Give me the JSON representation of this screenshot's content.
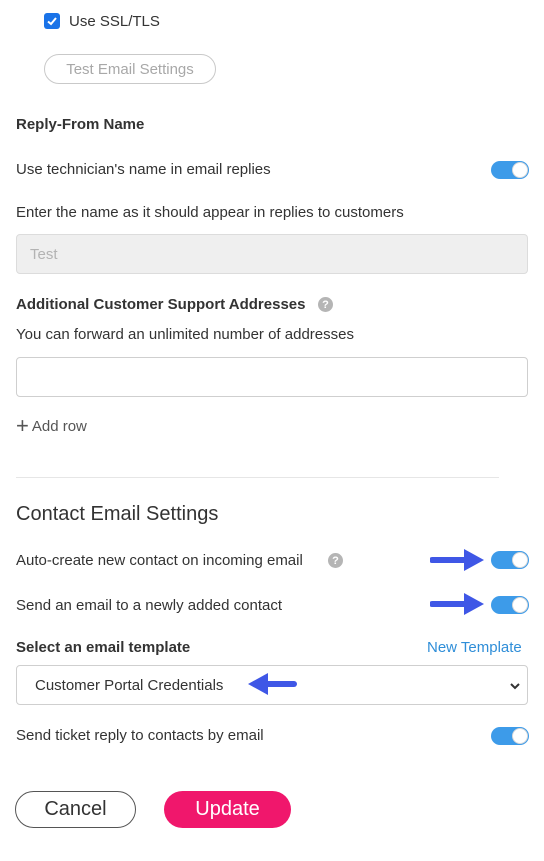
{
  "ssl": {
    "label": "Use SSL/TLS",
    "checked": true
  },
  "test_button": {
    "label": "Test Email Settings"
  },
  "reply_from": {
    "heading": "Reply-From Name",
    "toggle_label": "Use technician's name in email replies",
    "toggle_on": true,
    "field_label": "Enter the name as it should appear in replies to customers",
    "field_placeholder": "Test"
  },
  "additional": {
    "heading": "Additional Customer Support Addresses",
    "help_icon": "?",
    "description": "You can forward an unlimited number of addresses",
    "input_value": "",
    "add_row_icon": "+",
    "add_row_label": "Add row"
  },
  "contact": {
    "title": "Contact Email Settings",
    "auto_create_label": "Auto-create new contact on incoming email",
    "auto_create_help": "?",
    "auto_create_on": true,
    "send_email_label": "Send an email to a newly added contact",
    "send_email_on": true,
    "template_label": "Select an email template",
    "new_template_link": "New Template",
    "template_value": "Customer Portal Credentials",
    "ticket_reply_label": "Send ticket reply to contacts by email",
    "ticket_reply_on": true
  },
  "actions": {
    "cancel": "Cancel",
    "update": "Update"
  },
  "colors": {
    "accent": "#3d9be9",
    "update": "#f0176c",
    "arrow": "#3f57e6",
    "link": "#2f8ed8",
    "checkbox": "#1a73e8"
  },
  "icons": {
    "checkbox_check": "check-icon",
    "select": "chevron-down-icon",
    "annotation": "arrow-left-icon"
  }
}
